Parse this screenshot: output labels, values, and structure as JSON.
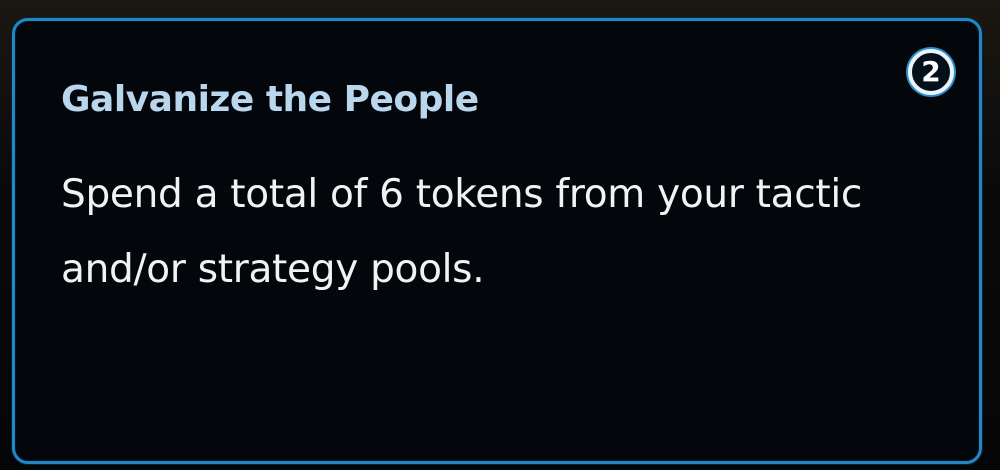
{
  "objective_card": {
    "points": "2",
    "title": "Galvanize the People",
    "description": "Spend a total of 6 tokens from your tactic and/or strategy pools.",
    "colors": {
      "border": "#1f88c7",
      "background": "#03070b",
      "title": "#b9d6ec",
      "text": "#f2f2f2"
    }
  }
}
